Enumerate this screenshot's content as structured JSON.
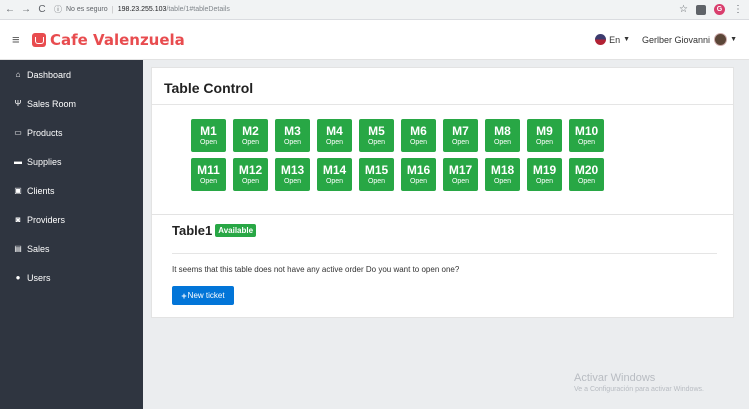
{
  "browser": {
    "insecure_label": "No es seguro",
    "url_host": "198.23.255.103",
    "url_path": "/table/1#tableDetails",
    "profile_initial": "G"
  },
  "navbar": {
    "brand": "Cafe Valenzuela",
    "language": "En",
    "user_name": "Gerlber Giovanni"
  },
  "sidebar": {
    "items": [
      {
        "label": "Dashboard",
        "icon": "home-icon"
      },
      {
        "label": "Sales Room",
        "icon": "cutlery-icon"
      },
      {
        "label": "Products",
        "icon": "barcode-icon"
      },
      {
        "label": "Supplies",
        "icon": "drawer-icon"
      },
      {
        "label": "Clients",
        "icon": "user-card-icon"
      },
      {
        "label": "Providers",
        "icon": "truck-icon"
      },
      {
        "label": "Sales",
        "icon": "document-icon"
      },
      {
        "label": "Users",
        "icon": "users-icon"
      }
    ]
  },
  "main": {
    "title": "Table Control",
    "tables": [
      {
        "name": "M1",
        "state": "Open"
      },
      {
        "name": "M2",
        "state": "Open"
      },
      {
        "name": "M3",
        "state": "Open"
      },
      {
        "name": "M4",
        "state": "Open"
      },
      {
        "name": "M5",
        "state": "Open"
      },
      {
        "name": "M6",
        "state": "Open"
      },
      {
        "name": "M7",
        "state": "Open"
      },
      {
        "name": "M8",
        "state": "Open"
      },
      {
        "name": "M9",
        "state": "Open"
      },
      {
        "name": "M10",
        "state": "Open"
      },
      {
        "name": "M11",
        "state": "Open"
      },
      {
        "name": "M12",
        "state": "Open"
      },
      {
        "name": "M13",
        "state": "Open"
      },
      {
        "name": "M14",
        "state": "Open"
      },
      {
        "name": "M15",
        "state": "Open"
      },
      {
        "name": "M16",
        "state": "Open"
      },
      {
        "name": "M17",
        "state": "Open"
      },
      {
        "name": "M18",
        "state": "Open"
      },
      {
        "name": "M19",
        "state": "Open"
      },
      {
        "name": "M20",
        "state": "Open"
      }
    ]
  },
  "detail": {
    "table_name": "Table1",
    "status_badge": "Available",
    "message": "It seems that this table does not have any active order Do you want to open one?",
    "new_ticket_label": "New ticket"
  },
  "watermark": {
    "line1": "Activar Windows",
    "line2": "Ve a Configuración para activar Windows."
  },
  "colors": {
    "accent_green": "#28a745",
    "primary_blue": "#0275d8",
    "brand_red": "#e84c4f",
    "sidebar_bg": "#2f3540"
  }
}
